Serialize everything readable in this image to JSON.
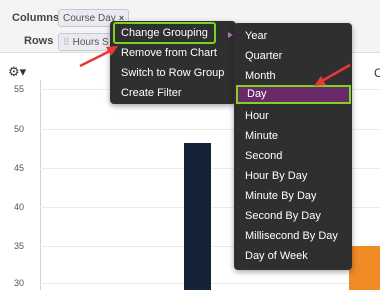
{
  "filters": {
    "columns_label": "Columns",
    "rows_label": "Rows",
    "columns_pill": "Course Day",
    "rows_pill": "Hours S"
  },
  "chart": {
    "y_ticks": [
      "55",
      "50",
      "45",
      "40",
      "35",
      "30"
    ],
    "edge_label": "C"
  },
  "context_menu": {
    "items": [
      "Change Grouping",
      "Remove from Chart",
      "Switch to Row Group",
      "Create Filter"
    ]
  },
  "grouping_menu": {
    "items": [
      "Year",
      "Quarter",
      "Month",
      "Day",
      "Hour",
      "Minute",
      "Second",
      "Hour By Day",
      "Minute By Day",
      "Second By Day",
      "Millisecond By Day",
      "Day of Week"
    ],
    "selected": "Day"
  },
  "colors": {
    "bar_dark": "#152338",
    "bar_orange": "#f08a24",
    "highlight_green": "#7ed321",
    "selected_purple": "#6a2a6a",
    "annotation_arrow": "#e53935",
    "menu_bg": "#2f2f2f"
  },
  "icons": {
    "gear": "gear-icon",
    "remove": "close-icon",
    "drag": "drag-handle-icon",
    "submenu": "chevron-right-icon",
    "arrow": "annotation-arrow-icon"
  }
}
